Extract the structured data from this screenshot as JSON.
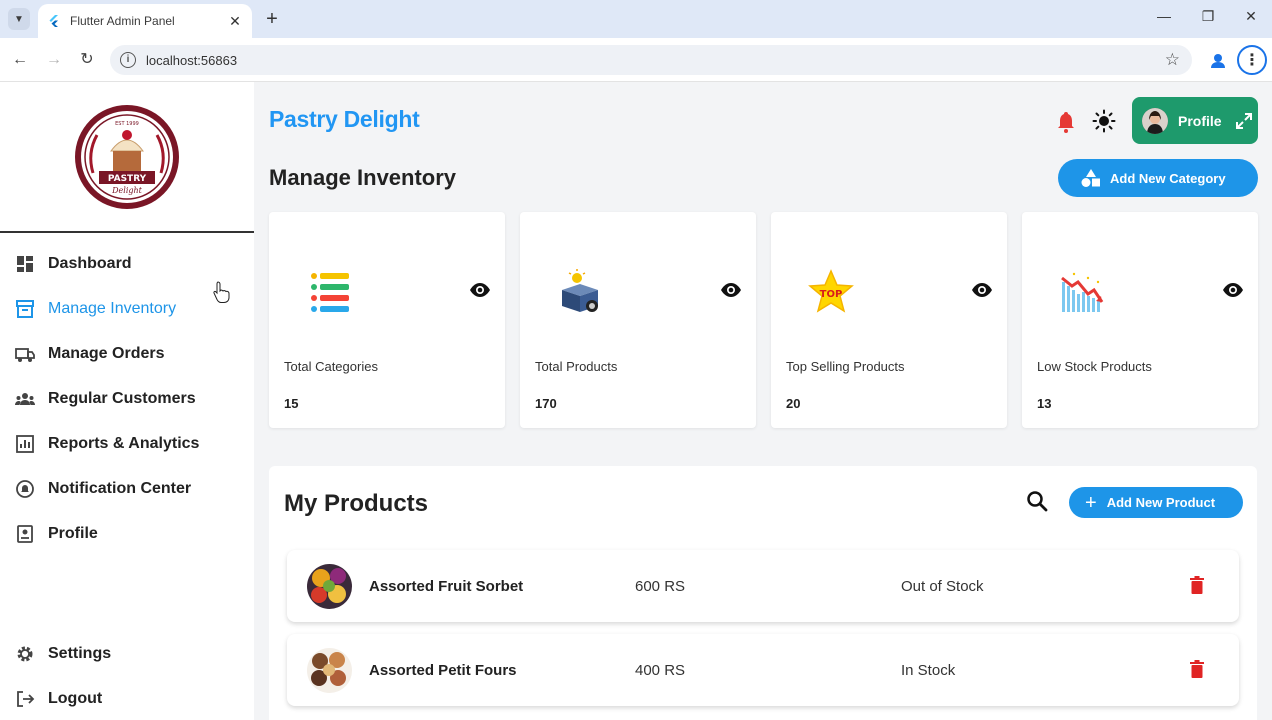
{
  "browser": {
    "tab_title": "Flutter Admin Panel",
    "url": "localhost:56863"
  },
  "sidebar": {
    "logo": {
      "top_text": "EST 1999",
      "name": "PASTRY",
      "tagline": "Delight"
    },
    "items": [
      {
        "label": "Dashboard",
        "icon": "dashboard-icon",
        "active": false
      },
      {
        "label": "Manage Inventory",
        "icon": "inventory-icon",
        "active": true
      },
      {
        "label": "Manage Orders",
        "icon": "truck-icon",
        "active": false
      },
      {
        "label": "Regular Customers",
        "icon": "customers-icon",
        "active": false
      },
      {
        "label": "Reports & Analytics",
        "icon": "chart-icon",
        "active": false
      },
      {
        "label": "Notification Center",
        "icon": "notification-icon",
        "active": false
      },
      {
        "label": "Profile",
        "icon": "profile-icon",
        "active": false
      }
    ],
    "bottom_items": [
      {
        "label": "Settings",
        "icon": "gear-icon"
      },
      {
        "label": "Logout",
        "icon": "logout-icon"
      }
    ]
  },
  "header": {
    "brand": "Pastry Delight",
    "profile_label": "Profile"
  },
  "inventory": {
    "title": "Manage Inventory",
    "add_category_label": "Add New Category",
    "cards": [
      {
        "label": "Total Categories",
        "value": "15",
        "icon": "list-icon"
      },
      {
        "label": "Total Products",
        "value": "170",
        "icon": "box-icon"
      },
      {
        "label": "Top Selling Products",
        "value": "20",
        "icon": "top-star-icon"
      },
      {
        "label": "Low Stock Products",
        "value": "13",
        "icon": "low-stock-chart-icon"
      }
    ]
  },
  "products": {
    "title": "My Products",
    "add_product_label": "Add New Product",
    "rows": [
      {
        "name": "Assorted Fruit Sorbet",
        "price": "600 RS",
        "stock": "Out of Stock"
      },
      {
        "name": "Assorted Petit Fours",
        "price": "400 RS",
        "stock": "In Stock"
      }
    ]
  },
  "colors": {
    "accent": "#2196f3",
    "button_blue": "#1e95e8",
    "profile_green": "#1e9a6c",
    "bell_red": "#e53935",
    "trash_red": "#e02424"
  }
}
